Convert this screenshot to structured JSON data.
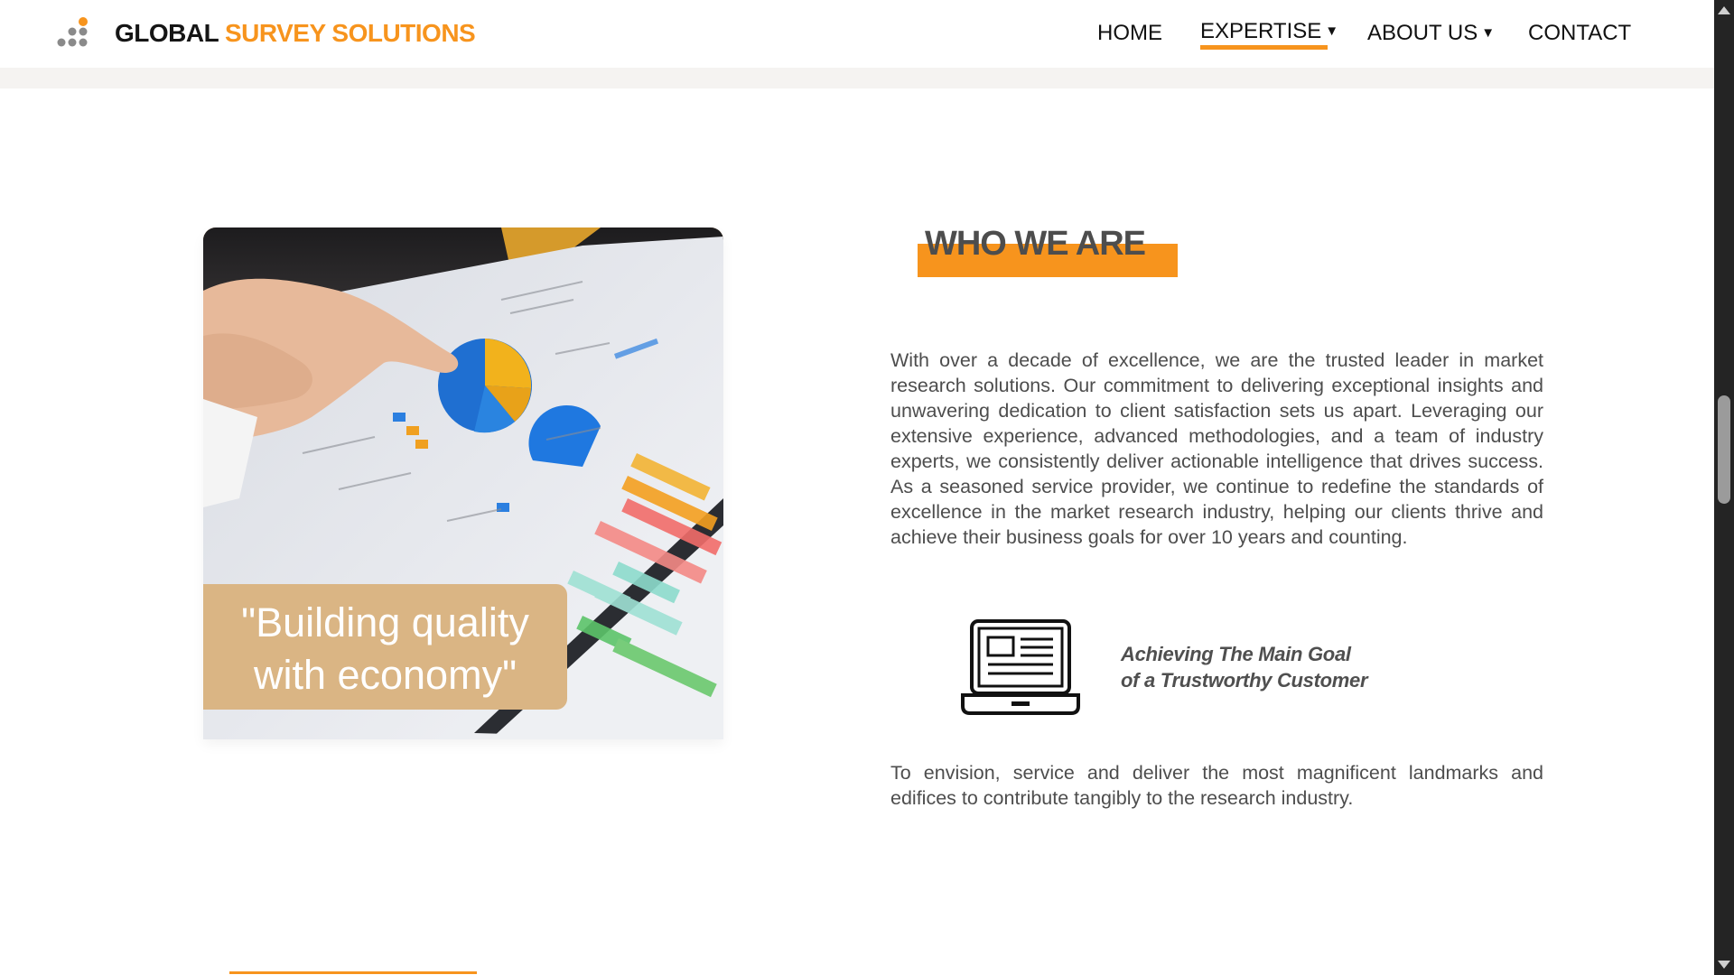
{
  "header": {
    "brand_part1": "GLOBAL",
    "brand_part2": "SURVEY SOLUTIONS",
    "logo_icon": "dots-logo-icon",
    "nav": {
      "home": "HOME",
      "expertise": "EXPERTISE",
      "about": "ABOUT US",
      "contact": "CONTACT",
      "active": "EXPERTISE",
      "caret_icon": "caret-down-icon"
    }
  },
  "hero": {
    "quote_line1": "\"Building quality",
    "quote_line2": "with economy\""
  },
  "who_we_are": {
    "title": "WHO WE ARE",
    "paragraph1": "With over a decade of excellence, we are the trusted leader in market research solutions. Our commitment to delivering exceptional insights and unwavering dedication to client satisfaction sets us apart. Leveraging our extensive experience, advanced methodologies, and a team of industry experts, we consistently deliver actionable intelligence that drives success. As a seasoned service provider, we continue to redefine the standards of excellence in the market research industry, helping our clients thrive and achieve their business goals for over 10 years and counting.",
    "goal_line1": "Achieving The Main Goal",
    "goal_line2": "of a Trustworthy Customer",
    "goal_icon": "laptop-icon",
    "paragraph2": "To envision, service and deliver the most magnificent landmarks and edifices to contribute tangibly to the research industry."
  },
  "colors": {
    "accent": "#f7941d",
    "quote_bg": "#dab584",
    "text": "#4d4d4d"
  }
}
